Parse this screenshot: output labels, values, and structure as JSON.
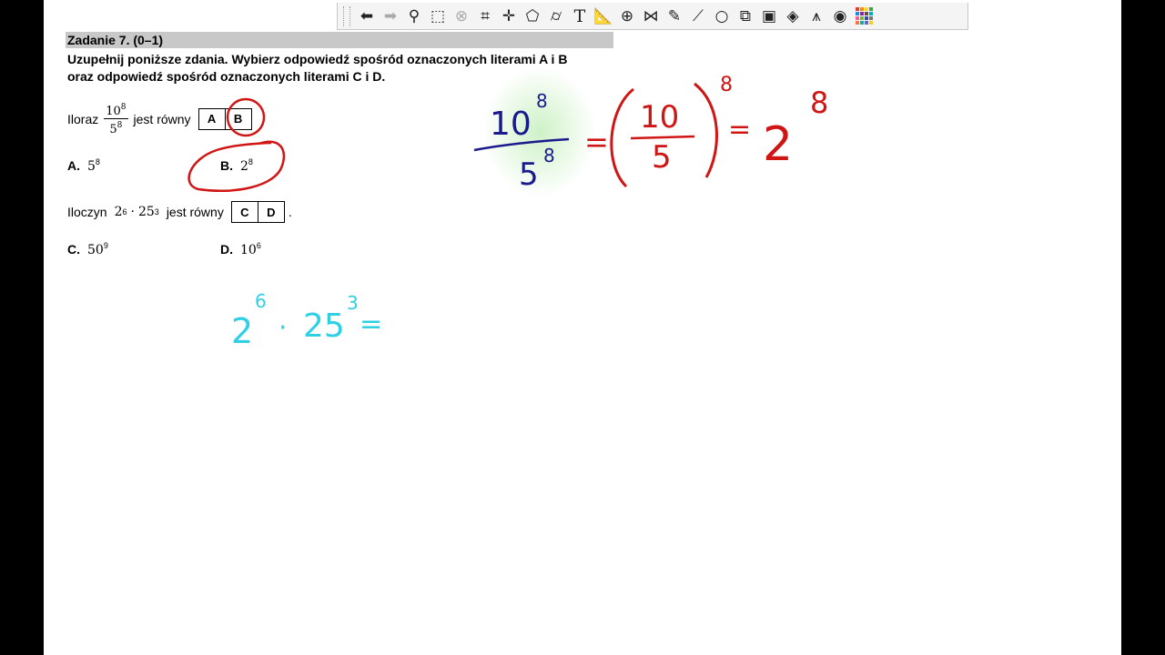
{
  "toolbar": {
    "tools": [
      {
        "name": "undo-icon",
        "glyph": "⬅"
      },
      {
        "name": "redo-icon",
        "glyph": "➡"
      },
      {
        "name": "zoom-icon",
        "glyph": "⚲"
      },
      {
        "name": "select-icon",
        "glyph": "⬚"
      },
      {
        "name": "delete-selection-icon",
        "glyph": "⊗"
      },
      {
        "name": "crop-icon",
        "glyph": "⌗"
      },
      {
        "name": "add-point-icon",
        "glyph": "✛"
      },
      {
        "name": "polygon-icon",
        "glyph": "⬠"
      },
      {
        "name": "cylinder-icon",
        "glyph": "⌭"
      },
      {
        "name": "text-icon",
        "glyph": "T"
      },
      {
        "name": "ruler-icon",
        "glyph": "📐"
      },
      {
        "name": "grid-sphere-icon",
        "glyph": "⊕"
      },
      {
        "name": "mirror-icon",
        "glyph": "⋈"
      },
      {
        "name": "pen-icon",
        "glyph": "✎"
      },
      {
        "name": "line-pen-icon",
        "glyph": "⟋"
      },
      {
        "name": "circle-icon",
        "glyph": "○"
      },
      {
        "name": "shapes-icon",
        "glyph": "⧉"
      },
      {
        "name": "image-icon",
        "glyph": "▣"
      },
      {
        "name": "layers-icon",
        "glyph": "◈"
      },
      {
        "name": "compass-icon",
        "glyph": "⩚"
      },
      {
        "name": "color-wheel-icon",
        "glyph": "◉"
      },
      {
        "name": "palette-icon",
        "glyph": ""
      }
    ],
    "palette_colors": [
      "#e53935",
      "#fb8c00",
      "#fdd835",
      "#43a047",
      "#1e88e5",
      "#8e24aa",
      "#6d4c41",
      "#00acc1",
      "#f06292",
      "#7cb342",
      "#3949ab",
      "#757575",
      "#ff7043",
      "#26a69a",
      "#5c6bc0",
      "#ffca28"
    ]
  },
  "task": {
    "header": "Zadanie 7. (0–1)",
    "instruction_line1": "Uzupełnij poniższe zdania. Wybierz odpowiedź spośród oznaczonych literami A i B",
    "instruction_line2": "oraz odpowiedź spośród oznaczonych literami C i D."
  },
  "question1": {
    "prefix": "Iloraz",
    "frac_num": "10",
    "frac_num_exp": "8",
    "frac_den": "5",
    "frac_den_exp": "8",
    "suffix": "jest równy",
    "box_left": "A",
    "box_right": "B",
    "opt_a_letter": "A.",
    "opt_a_base": "5",
    "opt_a_exp": "8",
    "opt_b_letter": "B.",
    "opt_b_base": "2",
    "opt_b_exp": "8"
  },
  "question2": {
    "prefix": "Iloczyn",
    "base1": "2",
    "exp1": "6",
    "dot": "·",
    "base2": "25",
    "exp2": "3",
    "suffix": "jest równy",
    "box_left": "C",
    "box_right": "D",
    "period": ".",
    "opt_c_letter": "C.",
    "opt_c_base": "50",
    "opt_c_exp": "9",
    "opt_d_letter": "D.",
    "opt_d_base": "10",
    "opt_d_exp": "6"
  },
  "annotations": {
    "blue_num": "10",
    "blue_num_exp": "8",
    "blue_den": "5",
    "blue_den_exp": "8",
    "red_eq1": "=",
    "red_frac_num": "10",
    "red_frac_den": "5",
    "red_outer_exp": "8",
    "red_eq2": "=",
    "red_result": "2",
    "red_result_exp": "8",
    "cyan_expr_base1": "2",
    "cyan_expr_exp1": "6",
    "cyan_expr_dot": "·",
    "cyan_expr_base2": "25",
    "cyan_expr_exp2": "3",
    "cyan_expr_eq": "=",
    "colors": {
      "blue": "#1a1a8c",
      "red": "#d01515",
      "cyan": "#2fd0e6",
      "highlight": "#c8f0c0"
    }
  }
}
